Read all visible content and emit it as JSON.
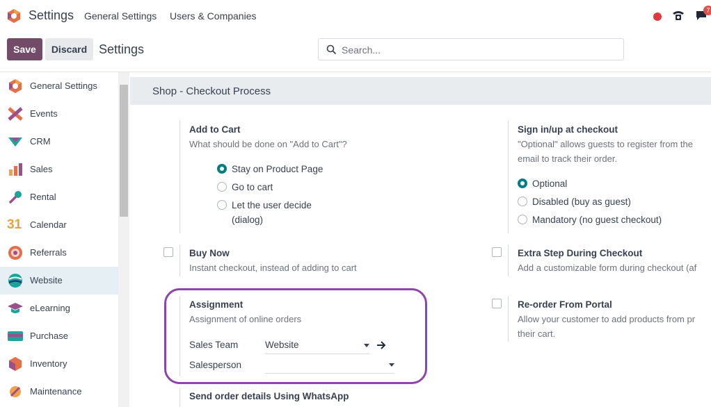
{
  "topbar": {
    "app_name": "Settings",
    "menu": [
      "General Settings",
      "Users & Companies"
    ],
    "notification_count": "7",
    "colors": {
      "status_dot": "#e03a3e",
      "badge": "#d9534f"
    }
  },
  "control_panel": {
    "save_label": "Save",
    "discard_label": "Discard",
    "title": "Settings",
    "search_placeholder": "Search..."
  },
  "sidebar": {
    "items": [
      {
        "label": "General Settings",
        "icon": "odoo-hexagon-icon"
      },
      {
        "label": "Events",
        "icon": "events-icon"
      },
      {
        "label": "CRM",
        "icon": "crm-icon"
      },
      {
        "label": "Sales",
        "icon": "sales-chart-icon"
      },
      {
        "label": "Rental",
        "icon": "rental-key-icon"
      },
      {
        "label": "Calendar",
        "icon": "calendar-icon",
        "glyph": "31"
      },
      {
        "label": "Referrals",
        "icon": "referrals-icon"
      },
      {
        "label": "Website",
        "icon": "website-globe-icon",
        "active": true
      },
      {
        "label": "eLearning",
        "icon": "elearning-cap-icon"
      },
      {
        "label": "Purchase",
        "icon": "purchase-card-icon"
      },
      {
        "label": "Inventory",
        "icon": "inventory-box-icon"
      },
      {
        "label": "Maintenance",
        "icon": "maintenance-icon"
      }
    ]
  },
  "section": {
    "title": "Shop - Checkout Process",
    "add_to_cart": {
      "title": "Add to Cart",
      "desc": "What should be done on \"Add to Cart\"?",
      "options": [
        "Stay on Product Page",
        "Go to cart",
        "Let the user decide",
        "(dialog)"
      ],
      "selected": 0
    },
    "sign_in": {
      "title": "Sign in/up at checkout",
      "desc_line1": "\"Optional\" allows guests to register from the",
      "desc_line2": "email to track their order.",
      "options": [
        "Optional",
        "Disabled (buy as guest)",
        "Mandatory (no guest checkout)"
      ],
      "selected": 0
    },
    "buy_now": {
      "title": "Buy Now",
      "desc": "Instant checkout, instead of adding to cart",
      "checked": false
    },
    "extra_step": {
      "title": "Extra Step During Checkout",
      "desc": "Add a customizable form during checkout (af",
      "checked": false
    },
    "assignment": {
      "title": "Assignment",
      "desc": "Assignment of online orders",
      "sales_team_label": "Sales Team",
      "sales_team_value": "Website",
      "salesperson_label": "Salesperson",
      "salesperson_value": ""
    },
    "reorder": {
      "title": "Re-order From Portal",
      "desc_line1": "Allow your customer to add products from pr",
      "desc_line2": "their cart.",
      "checked": false
    },
    "whatsapp": {
      "title": "Send order details Using WhatsApp"
    }
  },
  "accent_color": "#714B67",
  "radio_color": "#017e84",
  "highlight_color": "#8e44ad"
}
